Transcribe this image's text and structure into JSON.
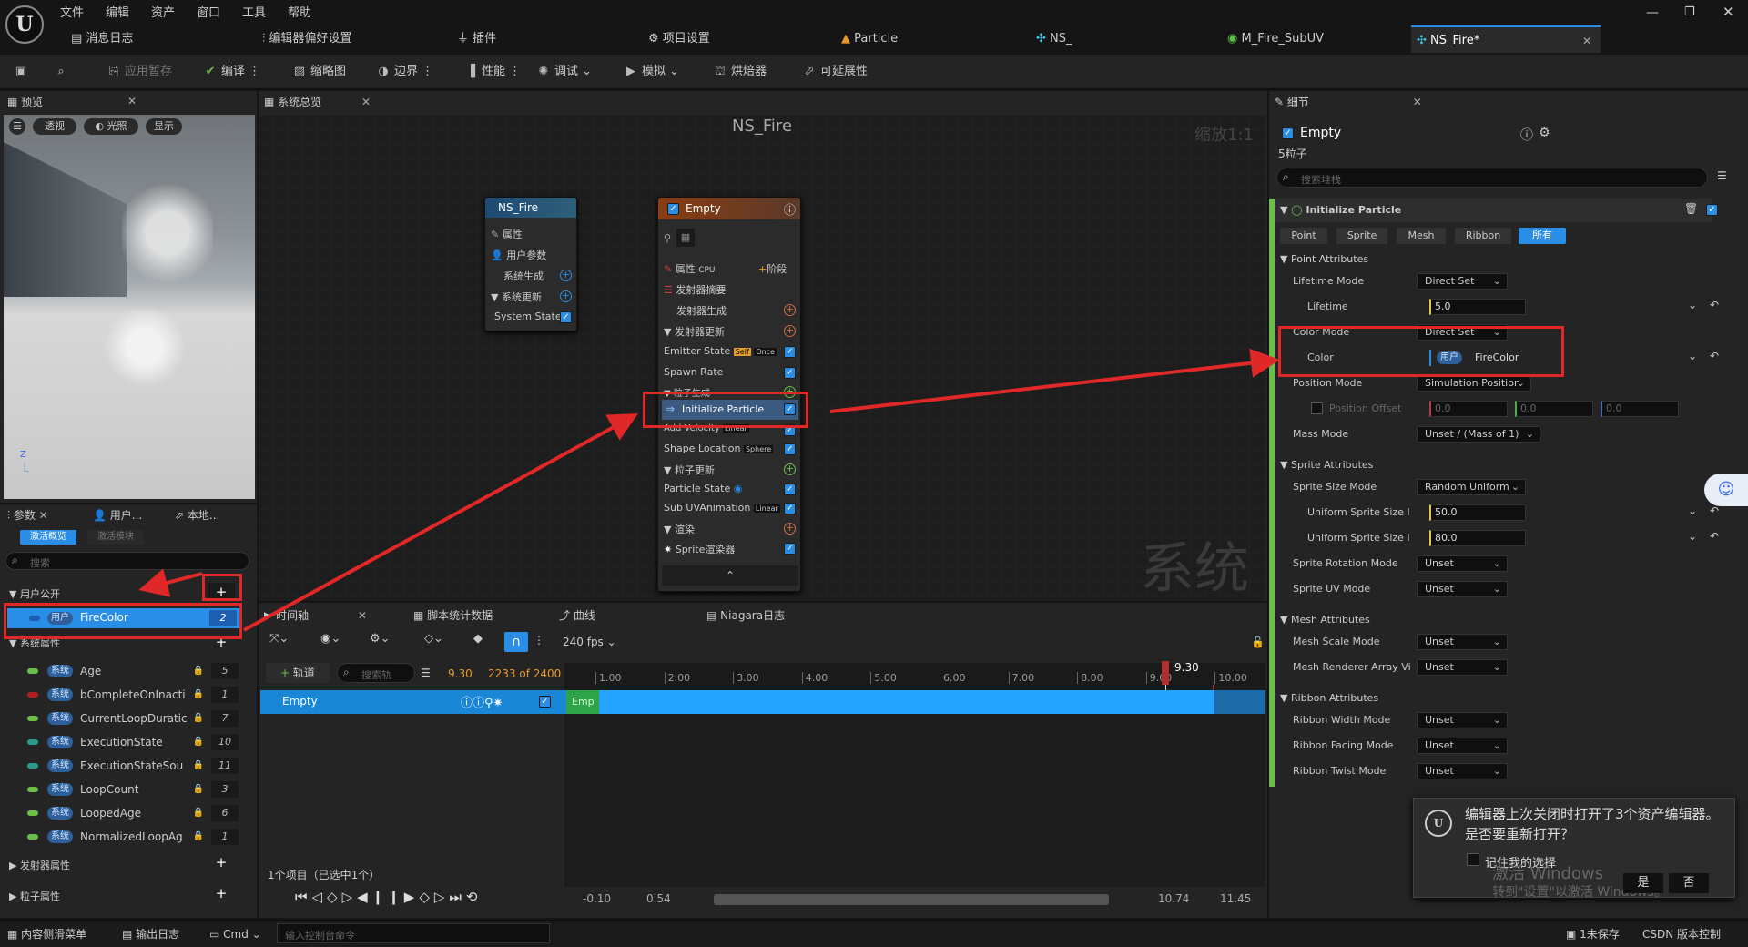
{
  "menu": {
    "items": [
      "文件",
      "编辑",
      "资产",
      "窗口",
      "工具",
      "帮助"
    ]
  },
  "doc_tabs": [
    "消息日志",
    "编辑器偏好设置",
    "插件",
    "项目设置",
    "Particle",
    "NS_",
    "M_Fire_SubUV",
    "NS_Fire*"
  ],
  "toolbar": {
    "items": [
      "应用暂存",
      "编译",
      "缩略图",
      "边界",
      "性能",
      "调试",
      "模拟",
      "烘焙器",
      "可延展性"
    ]
  },
  "preview": {
    "tab": "预览",
    "btn_persp": "透视",
    "btn_light": "光照",
    "btn_show": "显示"
  },
  "overview": {
    "tab": "系统总览",
    "title": "NS_Fire",
    "zoom": "缩放1:1",
    "watermark": "系统"
  },
  "sys_node": {
    "title": "NS_Fire",
    "rows": [
      "属性",
      "用户参数",
      "系统生成",
      "系统更新",
      "System State"
    ]
  },
  "emitter_node": {
    "title": "Empty",
    "props": "属性",
    "stage": "阶段",
    "summary": "发射器摘要",
    "spawn": "发射器生成",
    "update": "发射器更新",
    "emitter_state": "Emitter State",
    "self": "Self",
    "once": "Once",
    "spawn_rate": "Spawn Rate",
    "particle_spawn": "粒子生成",
    "init": "Initialize Particle",
    "add_vel": "Add Velocity",
    "linear": "Linear",
    "shape": "Shape Location",
    "sphere": "Sphere",
    "particle_update": "粒子更新",
    "particle_state": "Particle State",
    "subuv": "Sub UVAnimation",
    "render": "渲染",
    "sprite_renderer": "Sprite渲染器"
  },
  "params": {
    "tabs": [
      "参数",
      "用户...",
      "本地..."
    ],
    "btn_active": "激活概览",
    "btn_module": "激活模块",
    "search": "搜索",
    "user_section": "用户公开",
    "user_badge": "用户",
    "user_param": "FireColor",
    "user_idx": "2",
    "sys_section": "系统属性",
    "sys_badge": "系统",
    "sys_params": [
      {
        "name": "Age",
        "idx": "5",
        "color": "#6abf4b"
      },
      {
        "name": "bCompleteOnInacti",
        "idx": "1",
        "color": "#b02020"
      },
      {
        "name": "CurrentLoopDuratic",
        "idx": "7",
        "color": "#6abf4b"
      },
      {
        "name": "ExecutionState",
        "idx": "10",
        "color": "#2a9a8a"
      },
      {
        "name": "ExecutionStateSou",
        "idx": "11",
        "color": "#2a9a8a"
      },
      {
        "name": "LoopCount",
        "idx": "3",
        "color": "#6abf4b"
      },
      {
        "name": "LoopedAge",
        "idx": "6",
        "color": "#6abf4b"
      },
      {
        "name": "NormalizedLoopAg",
        "idx": "1",
        "color": "#6abf4b"
      }
    ],
    "emitter_props": "发射器属性",
    "particle_props": "粒子属性"
  },
  "timeline": {
    "tabs": [
      "时间轴",
      "脚本统计数据",
      "曲线",
      "Niagara日志"
    ],
    "fps": "240 fps",
    "track_btn": "轨道",
    "search": "搜索轨",
    "time": "9.30",
    "frames": "2233 of 2400",
    "marker": "9.30",
    "ticks": [
      "1.00",
      "2.00",
      "3.00",
      "4.00",
      "5.00",
      "6.00",
      "7.00",
      "8.00",
      "9.00",
      "10.00"
    ],
    "track_name": "Empty",
    "track_bar_label": "Emp",
    "count": "1个项目（已选中1个）",
    "range": [
      "-0.10",
      "0.54",
      "10.74",
      "11.45"
    ]
  },
  "details": {
    "tab": "细节",
    "name": "Empty",
    "count": "5粒子",
    "search": "搜索堆栈",
    "module": "Initialize Particle",
    "cats": [
      "Point",
      "Sprite",
      "Mesh",
      "Ribbon",
      "所有"
    ],
    "sections": {
      "point": "Point Attributes",
      "sprite": "Sprite Attributes",
      "mesh": "Mesh Attributes",
      "ribbon": "Ribbon Attributes"
    },
    "rows": {
      "lifetime_mode": "Lifetime Mode",
      "lifetime_mode_v": "Direct Set",
      "lifetime": "Lifetime",
      "lifetime_v": "5.0",
      "color_mode": "Color Mode",
      "color_mode_v": "Direct Set",
      "color": "Color",
      "color_badge": "用户",
      "color_v": "FireColor",
      "pos_mode": "Position Mode",
      "pos_mode_v": "Simulation Position",
      "pos_offset": "Position Offset",
      "po_x": "0.0",
      "po_y": "0.0",
      "po_z": "0.0",
      "mass_mode": "Mass Mode",
      "mass_mode_v": "Unset / (Mass of 1)",
      "size_mode": "Sprite Size Mode",
      "size_mode_v": "Random Uniform",
      "size_min": "Uniform Sprite Size I",
      "size_min_v": "50.0",
      "size_max": "Uniform Sprite Size I",
      "size_max_v": "80.0",
      "rot_mode": "Sprite Rotation Mode",
      "rot_mode_v": "Unset",
      "uv_mode": "Sprite UV Mode",
      "uv_mode_v": "Unset",
      "mesh_scale": "Mesh Scale Mode",
      "mesh_scale_v": "Unset",
      "mesh_arr": "Mesh Renderer Array Vi",
      "mesh_arr_v": "Unset",
      "rb_width": "Ribbon Width Mode",
      "rb_width_v": "Unset",
      "rb_facing": "Ribbon Facing Mode",
      "rb_facing_v": "Unset",
      "rb_twist": "Ribbon Twist Mode",
      "rb_twist_v": "Unset"
    }
  },
  "toast": {
    "msg": "编辑器上次关闭时打开了3个资产编辑器。是否要重新打开？",
    "remember": "记住我的选择",
    "yes": "是",
    "no": "否",
    "watermark1": "激活 Windows",
    "watermark2": "转到\"设置\"以激活 Windows。"
  },
  "status": {
    "drawer": "内容侧滑菜单",
    "log": "输出日志",
    "cmd": "Cmd",
    "console": "输入控制台命令",
    "unsaved": "1未保存",
    "src": "版本控制",
    "csdn": "CSDN"
  }
}
